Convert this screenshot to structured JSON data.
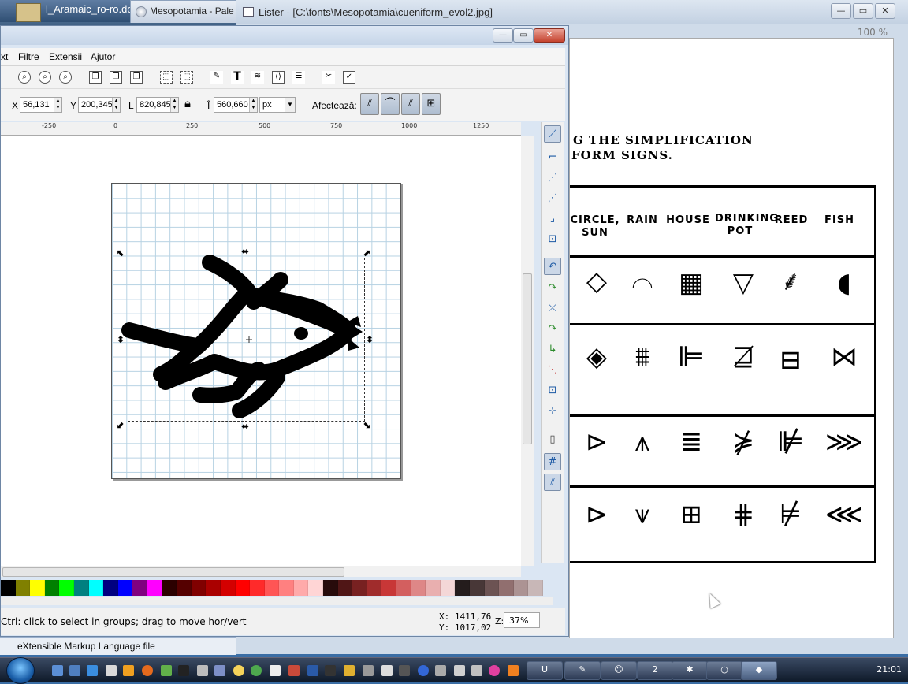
{
  "background_windows": {
    "word_title": "l_Aramaic_ro-ro.do",
    "browser_tab": "Mesopotamia - Pale"
  },
  "lister": {
    "title": "Lister - [C:\\fonts\\Mesopotamia\\cueniform_evol2.jpg]",
    "zoom": "100 %",
    "heading_line1": "G THE SIMPLIFICATION",
    "heading_line2": "FORM SIGNS.",
    "columns": [
      "CIRCLE, SUN",
      "RAIN",
      "HOUSE",
      "DRINKING POT",
      "REED",
      "FISH"
    ]
  },
  "inkscape": {
    "menu": [
      "xt",
      "Filtre",
      "Extensii",
      "Ajutor"
    ],
    "toolbar2": {
      "x_label": "X",
      "x_value": "56,131",
      "y_label": "Y",
      "y_value": "200,345",
      "w_label": "L",
      "w_value": "820,845",
      "h_label": "Î",
      "h_value": "560,660",
      "unit": "px",
      "affect_label": "Afectează:"
    },
    "ruler_labels": [
      "-250",
      "0",
      "250",
      "500",
      "750",
      "1000",
      "1250"
    ],
    "status_text": "Ctrl: click to select in groups; drag to move hor/vert",
    "coords_x": "X: 1411,76",
    "coords_y": "Y: 1017,02",
    "zoom_label": "Z:",
    "zoom_value": "37%",
    "palette": [
      "#000000",
      "#808000",
      "#ffff00",
      "#008000",
      "#00ff00",
      "#008080",
      "#00ffff",
      "#000080",
      "#0000ff",
      "#800080",
      "#ff00ff",
      "#2b0000",
      "#550000",
      "#800000",
      "#aa0000",
      "#d40000",
      "#ff0000",
      "#ff2a2a",
      "#ff5555",
      "#ff8080",
      "#ffaaaa",
      "#ffd5d5",
      "#280b0b",
      "#501616",
      "#782121",
      "#a02c2c",
      "#c83737",
      "#d35f5f",
      "#de8787",
      "#e9afaf",
      "#f4d7d7",
      "#241c1c",
      "#483737",
      "#6c5353",
      "#916f6f",
      "#ac9393",
      "#c8b7b7"
    ]
  },
  "hint": "eXtensible Markup Language file",
  "taskbar": {
    "clock": "21:01"
  }
}
